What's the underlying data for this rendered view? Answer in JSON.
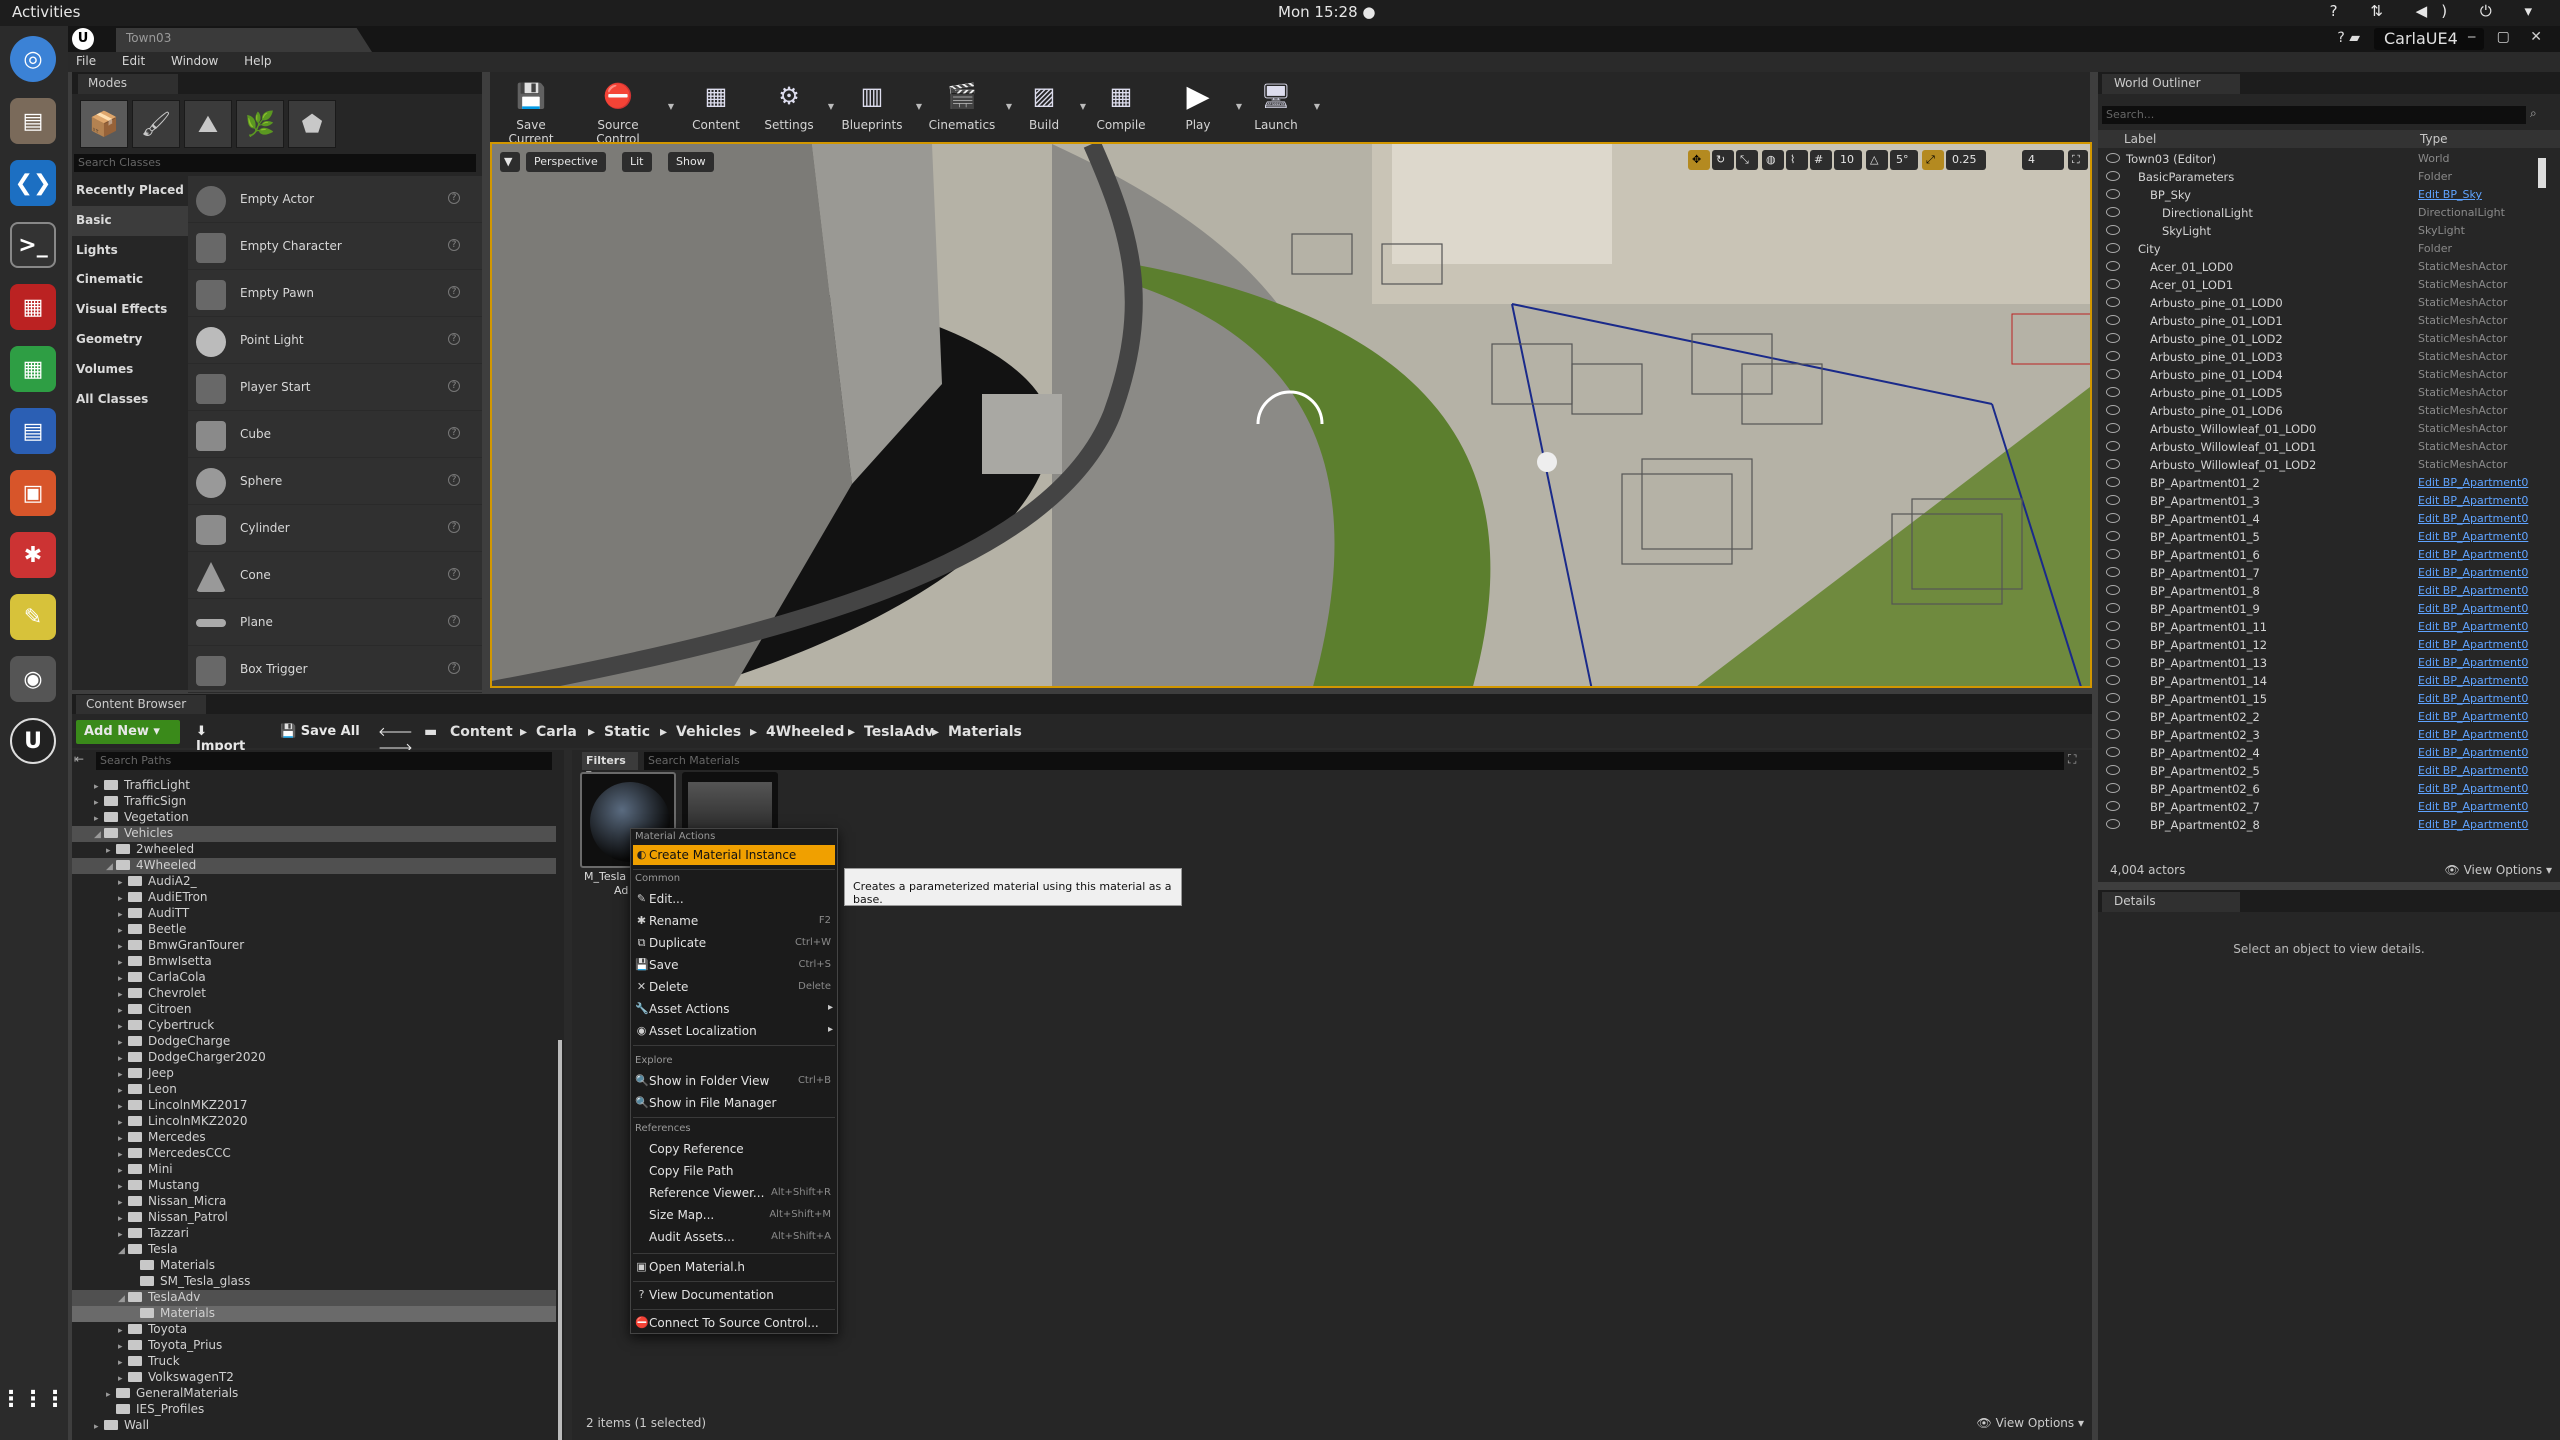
{
  "gnome": {
    "activities": "Activities",
    "clock": "Mon 15:28 ●"
  },
  "window": {
    "tab_title": "Town03",
    "project": "CarlaUE4"
  },
  "menu": [
    "File",
    "Edit",
    "Window",
    "Help"
  ],
  "modes": {
    "title": "Modes",
    "search_placeholder": "Search Classes",
    "categories": [
      "Recently Placed",
      "Basic",
      "Lights",
      "Cinematic",
      "Visual Effects",
      "Geometry",
      "Volumes",
      "All Classes"
    ],
    "selected_category": "Basic",
    "items": [
      "Empty Actor",
      "Empty Character",
      "Empty Pawn",
      "Point Light",
      "Player Start",
      "Cube",
      "Sphere",
      "Cylinder",
      "Cone",
      "Plane",
      "Box Trigger"
    ]
  },
  "toolbar": [
    "Save Current",
    "Source Control",
    "Content",
    "Settings",
    "Blueprints",
    "Cinematics",
    "Build",
    "Compile",
    "Play",
    "Launch"
  ],
  "viewport": {
    "perspective": "Perspective",
    "lit": "Lit",
    "show": "Show",
    "grid": "10",
    "angle": "5°",
    "scale": "0.25",
    "cams": "4"
  },
  "content_browser": {
    "title": "Content Browser",
    "add_new": "Add New",
    "import": "Import",
    "save_all": "Save All",
    "breadcrumb": [
      "Content",
      "Carla",
      "Static",
      "Vehicles",
      "4Wheeled",
      "TeslaAdv",
      "Materials"
    ],
    "search_paths": "Search Paths",
    "filters": "Filters",
    "search_materials": "Search Materials",
    "status": "2 items (1 selected)",
    "view_options": "View Options",
    "tree": [
      "TrafficLight",
      "TrafficSign",
      "Vegetation",
      "Vehicles",
      "2wheeled",
      "4Wheeled",
      "AudiA2_",
      "AudiETron",
      "AudiTT",
      "Beetle",
      "BmwGranTourer",
      "BmwIsetta",
      "CarlaCola",
      "Chevrolet",
      "Citroen",
      "Cybertruck",
      "DodgeCharge",
      "DodgeCharger2020",
      "Jeep",
      "Leon",
      "LincolnMKZ2017",
      "LincolnMKZ2020",
      "Mercedes",
      "MercedesCCC",
      "Mini",
      "Mustang",
      "Nissan_Micra",
      "Nissan_Patrol",
      "Tazzari",
      "Tesla",
      "Materials",
      "SM_Tesla_glass",
      "TeslaAdv",
      "Materials",
      "Toyota",
      "Toyota_Prius",
      "Truck",
      "VolkswagenT2",
      "GeneralMaterials",
      "IES_Profiles",
      "Wall"
    ],
    "asset_label": "M_Tesla",
    "asset_label2": "Ad"
  },
  "context_menu": {
    "sec_material": "Material Actions",
    "create_instance": "Create Material Instance",
    "sec_common": "Common",
    "edit": "Edit...",
    "rename": "Rename",
    "rename_sc": "F2",
    "duplicate": "Duplicate",
    "duplicate_sc": "Ctrl+W",
    "save": "Save",
    "save_sc": "Ctrl+S",
    "delete": "Delete",
    "delete_sc": "Delete",
    "asset_actions": "Asset Actions",
    "asset_localization": "Asset Localization",
    "sec_explore": "Explore",
    "show_folder": "Show in Folder View",
    "show_folder_sc": "Ctrl+B",
    "show_fm": "Show in File Manager",
    "sec_refs": "References",
    "copy_ref": "Copy Reference",
    "copy_path": "Copy File Path",
    "ref_viewer": "Reference Viewer...",
    "ref_viewer_sc": "Alt+Shift+R",
    "size_map": "Size Map...",
    "size_map_sc": "Alt+Shift+M",
    "audit": "Audit Assets...",
    "audit_sc": "Alt+Shift+A",
    "open_h": "Open Material.h",
    "view_docs": "View Documentation",
    "connect_sc": "Connect To Source Control..."
  },
  "tooltip": "Creates a parameterized material using this material as a base.",
  "outliner": {
    "title": "World Outliner",
    "search_placeholder": "Search...",
    "col_label": "Label",
    "col_type": "Type",
    "rows": [
      {
        "label": "Town03 (Editor)",
        "type": "World",
        "link": false,
        "indent": 0
      },
      {
        "label": "BasicParameters",
        "type": "Folder",
        "link": false,
        "indent": 1
      },
      {
        "label": "BP_Sky",
        "type": "Edit BP_Sky",
        "link": true,
        "indent": 2
      },
      {
        "label": "DirectionalLight",
        "type": "DirectionalLight",
        "link": false,
        "indent": 3
      },
      {
        "label": "SkyLight",
        "type": "SkyLight",
        "link": false,
        "indent": 3
      },
      {
        "label": "City",
        "type": "Folder",
        "link": false,
        "indent": 1
      },
      {
        "label": "Acer_01_LOD0",
        "type": "StaticMeshActor",
        "link": false,
        "indent": 2
      },
      {
        "label": "Acer_01_LOD1",
        "type": "StaticMeshActor",
        "link": false,
        "indent": 2
      },
      {
        "label": "Arbusto_pine_01_LOD0",
        "type": "StaticMeshActor",
        "link": false,
        "indent": 2
      },
      {
        "label": "Arbusto_pine_01_LOD1",
        "type": "StaticMeshActor",
        "link": false,
        "indent": 2
      },
      {
        "label": "Arbusto_pine_01_LOD2",
        "type": "StaticMeshActor",
        "link": false,
        "indent": 2
      },
      {
        "label": "Arbusto_pine_01_LOD3",
        "type": "StaticMeshActor",
        "link": false,
        "indent": 2
      },
      {
        "label": "Arbusto_pine_01_LOD4",
        "type": "StaticMeshActor",
        "link": false,
        "indent": 2
      },
      {
        "label": "Arbusto_pine_01_LOD5",
        "type": "StaticMeshActor",
        "link": false,
        "indent": 2
      },
      {
        "label": "Arbusto_pine_01_LOD6",
        "type": "StaticMeshActor",
        "link": false,
        "indent": 2
      },
      {
        "label": "Arbusto_Willowleaf_01_LOD0",
        "type": "StaticMeshActor",
        "link": false,
        "indent": 2
      },
      {
        "label": "Arbusto_Willowleaf_01_LOD1",
        "type": "StaticMeshActor",
        "link": false,
        "indent": 2
      },
      {
        "label": "Arbusto_Willowleaf_01_LOD2",
        "type": "StaticMeshActor",
        "link": false,
        "indent": 2
      },
      {
        "label": "BP_Apartment01_2",
        "type": "Edit BP_Apartment0",
        "link": true,
        "indent": 2
      },
      {
        "label": "BP_Apartment01_3",
        "type": "Edit BP_Apartment0",
        "link": true,
        "indent": 2
      },
      {
        "label": "BP_Apartment01_4",
        "type": "Edit BP_Apartment0",
        "link": true,
        "indent": 2
      },
      {
        "label": "BP_Apartment01_5",
        "type": "Edit BP_Apartment0",
        "link": true,
        "indent": 2
      },
      {
        "label": "BP_Apartment01_6",
        "type": "Edit BP_Apartment0",
        "link": true,
        "indent": 2
      },
      {
        "label": "BP_Apartment01_7",
        "type": "Edit BP_Apartment0",
        "link": true,
        "indent": 2
      },
      {
        "label": "BP_Apartment01_8",
        "type": "Edit BP_Apartment0",
        "link": true,
        "indent": 2
      },
      {
        "label": "BP_Apartment01_9",
        "type": "Edit BP_Apartment0",
        "link": true,
        "indent": 2
      },
      {
        "label": "BP_Apartment01_11",
        "type": "Edit BP_Apartment0",
        "link": true,
        "indent": 2
      },
      {
        "label": "BP_Apartment01_12",
        "type": "Edit BP_Apartment0",
        "link": true,
        "indent": 2
      },
      {
        "label": "BP_Apartment01_13",
        "type": "Edit BP_Apartment0",
        "link": true,
        "indent": 2
      },
      {
        "label": "BP_Apartment01_14",
        "type": "Edit BP_Apartment0",
        "link": true,
        "indent": 2
      },
      {
        "label": "BP_Apartment01_15",
        "type": "Edit BP_Apartment0",
        "link": true,
        "indent": 2
      },
      {
        "label": "BP_Apartment02_2",
        "type": "Edit BP_Apartment0",
        "link": true,
        "indent": 2
      },
      {
        "label": "BP_Apartment02_3",
        "type": "Edit BP_Apartment0",
        "link": true,
        "indent": 2
      },
      {
        "label": "BP_Apartment02_4",
        "type": "Edit BP_Apartment0",
        "link": true,
        "indent": 2
      },
      {
        "label": "BP_Apartment02_5",
        "type": "Edit BP_Apartment0",
        "link": true,
        "indent": 2
      },
      {
        "label": "BP_Apartment02_6",
        "type": "Edit BP_Apartment0",
        "link": true,
        "indent": 2
      },
      {
        "label": "BP_Apartment02_7",
        "type": "Edit BP_Apartment0",
        "link": true,
        "indent": 2
      },
      {
        "label": "BP_Apartment02_8",
        "type": "Edit BP_Apartment0",
        "link": true,
        "indent": 2
      }
    ],
    "actor_count": "4,004 actors",
    "view_options": "View Options"
  },
  "details": {
    "title": "Details",
    "empty": "Select an object to view details."
  },
  "colors": {
    "accent": "#f0a000",
    "link": "#5fa3ff",
    "panel": "#262626"
  }
}
